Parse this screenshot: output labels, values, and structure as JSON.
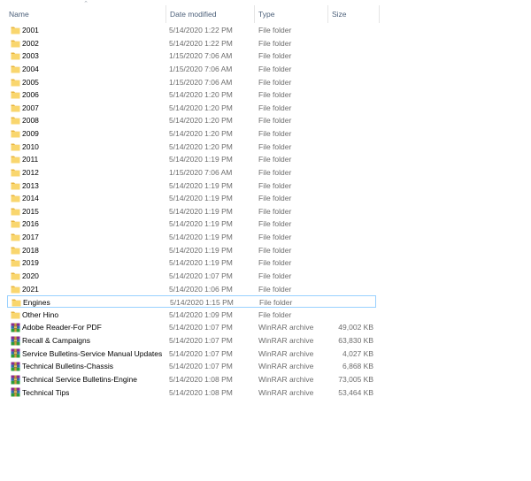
{
  "columns": {
    "name": "Name",
    "date_modified": "Date modified",
    "type": "Type",
    "size": "Size"
  },
  "selected_item": "Engines",
  "items": [
    {
      "name": "2001",
      "date": "5/14/2020 1:22 PM",
      "type": "File folder",
      "size": "",
      "icon": "folder-icon"
    },
    {
      "name": "2002",
      "date": "5/14/2020 1:22 PM",
      "type": "File folder",
      "size": "",
      "icon": "folder-icon"
    },
    {
      "name": "2003",
      "date": "1/15/2020 7:06 AM",
      "type": "File folder",
      "size": "",
      "icon": "folder-icon"
    },
    {
      "name": "2004",
      "date": "1/15/2020 7:06 AM",
      "type": "File folder",
      "size": "",
      "icon": "folder-icon"
    },
    {
      "name": "2005",
      "date": "1/15/2020 7:06 AM",
      "type": "File folder",
      "size": "",
      "icon": "folder-icon"
    },
    {
      "name": "2006",
      "date": "5/14/2020 1:20 PM",
      "type": "File folder",
      "size": "",
      "icon": "folder-icon"
    },
    {
      "name": "2007",
      "date": "5/14/2020 1:20 PM",
      "type": "File folder",
      "size": "",
      "icon": "folder-icon"
    },
    {
      "name": "2008",
      "date": "5/14/2020 1:20 PM",
      "type": "File folder",
      "size": "",
      "icon": "folder-icon"
    },
    {
      "name": "2009",
      "date": "5/14/2020 1:20 PM",
      "type": "File folder",
      "size": "",
      "icon": "folder-icon"
    },
    {
      "name": "2010",
      "date": "5/14/2020 1:20 PM",
      "type": "File folder",
      "size": "",
      "icon": "folder-icon"
    },
    {
      "name": "2011",
      "date": "5/14/2020 1:19 PM",
      "type": "File folder",
      "size": "",
      "icon": "folder-icon"
    },
    {
      "name": "2012",
      "date": "1/15/2020 7:06 AM",
      "type": "File folder",
      "size": "",
      "icon": "folder-icon"
    },
    {
      "name": "2013",
      "date": "5/14/2020 1:19 PM",
      "type": "File folder",
      "size": "",
      "icon": "folder-icon"
    },
    {
      "name": "2014",
      "date": "5/14/2020 1:19 PM",
      "type": "File folder",
      "size": "",
      "icon": "folder-icon"
    },
    {
      "name": "2015",
      "date": "5/14/2020 1:19 PM",
      "type": "File folder",
      "size": "",
      "icon": "folder-icon"
    },
    {
      "name": "2016",
      "date": "5/14/2020 1:19 PM",
      "type": "File folder",
      "size": "",
      "icon": "folder-icon"
    },
    {
      "name": "2017",
      "date": "5/14/2020 1:19 PM",
      "type": "File folder",
      "size": "",
      "icon": "folder-icon"
    },
    {
      "name": "2018",
      "date": "5/14/2020 1:19 PM",
      "type": "File folder",
      "size": "",
      "icon": "folder-icon"
    },
    {
      "name": "2019",
      "date": "5/14/2020 1:19 PM",
      "type": "File folder",
      "size": "",
      "icon": "folder-icon"
    },
    {
      "name": "2020",
      "date": "5/14/2020 1:07 PM",
      "type": "File folder",
      "size": "",
      "icon": "folder-icon"
    },
    {
      "name": "2021",
      "date": "5/14/2020 1:06 PM",
      "type": "File folder",
      "size": "",
      "icon": "folder-icon"
    },
    {
      "name": "Engines",
      "date": "5/14/2020 1:15 PM",
      "type": "File folder",
      "size": "",
      "icon": "folder-icon"
    },
    {
      "name": "Other Hino",
      "date": "5/14/2020 1:09 PM",
      "type": "File folder",
      "size": "",
      "icon": "folder-icon"
    },
    {
      "name": "Adobe Reader-For PDF",
      "date": "5/14/2020 1:07 PM",
      "type": "WinRAR archive",
      "size": "49,002 KB",
      "icon": "winrar-archive-icon"
    },
    {
      "name": "Recall & Campaigns",
      "date": "5/14/2020 1:07 PM",
      "type": "WinRAR archive",
      "size": "63,830 KB",
      "icon": "winrar-archive-icon"
    },
    {
      "name": "Service Bulletins-Service Manual Updates",
      "date": "5/14/2020 1:07 PM",
      "type": "WinRAR archive",
      "size": "4,027 KB",
      "icon": "winrar-archive-icon"
    },
    {
      "name": "Technical Bulletins-Chassis",
      "date": "5/14/2020 1:07 PM",
      "type": "WinRAR archive",
      "size": "6,868 KB",
      "icon": "winrar-archive-icon"
    },
    {
      "name": "Technical Service Bulletins-Engine",
      "date": "5/14/2020 1:08 PM",
      "type": "WinRAR archive",
      "size": "73,005 KB",
      "icon": "winrar-archive-icon"
    },
    {
      "name": "Technical Tips",
      "date": "5/14/2020 1:08 PM",
      "type": "WinRAR archive",
      "size": "53,464 KB",
      "icon": "winrar-archive-icon"
    }
  ],
  "colors": {
    "folder_body": "#f9d66e",
    "folder_tab": "#e8b43c",
    "selection_border": "#99d1ff",
    "header_text": "#4c607a",
    "secondary_text": "#6d6d6d"
  }
}
